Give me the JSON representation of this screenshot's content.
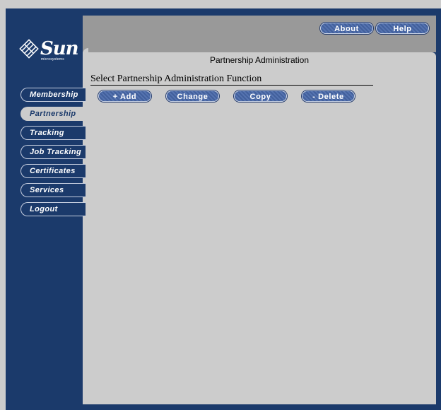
{
  "logo": {
    "word": "Sun",
    "sub": "microsystems"
  },
  "header": {
    "about_label": "About",
    "help_label": "Help"
  },
  "page": {
    "title": "Partnership Administration",
    "section_heading": "Select Partnership Administration Function"
  },
  "actions": {
    "add_label": "+ Add",
    "change_label": "Change",
    "copy_label": "Copy",
    "delete_label": "- Delete"
  },
  "sidebar": {
    "items": [
      {
        "label": "Membership"
      },
      {
        "label": "Partnership"
      },
      {
        "label": "Tracking"
      },
      {
        "label": "Job Tracking"
      },
      {
        "label": "Certificates"
      },
      {
        "label": "Services"
      },
      {
        "label": "Logout"
      }
    ],
    "active": "Partnership"
  },
  "colors": {
    "nav_background": "#1b3a6b",
    "header_bar": "#999999",
    "content_background": "#cccccc",
    "button_fill": "#42609c"
  }
}
